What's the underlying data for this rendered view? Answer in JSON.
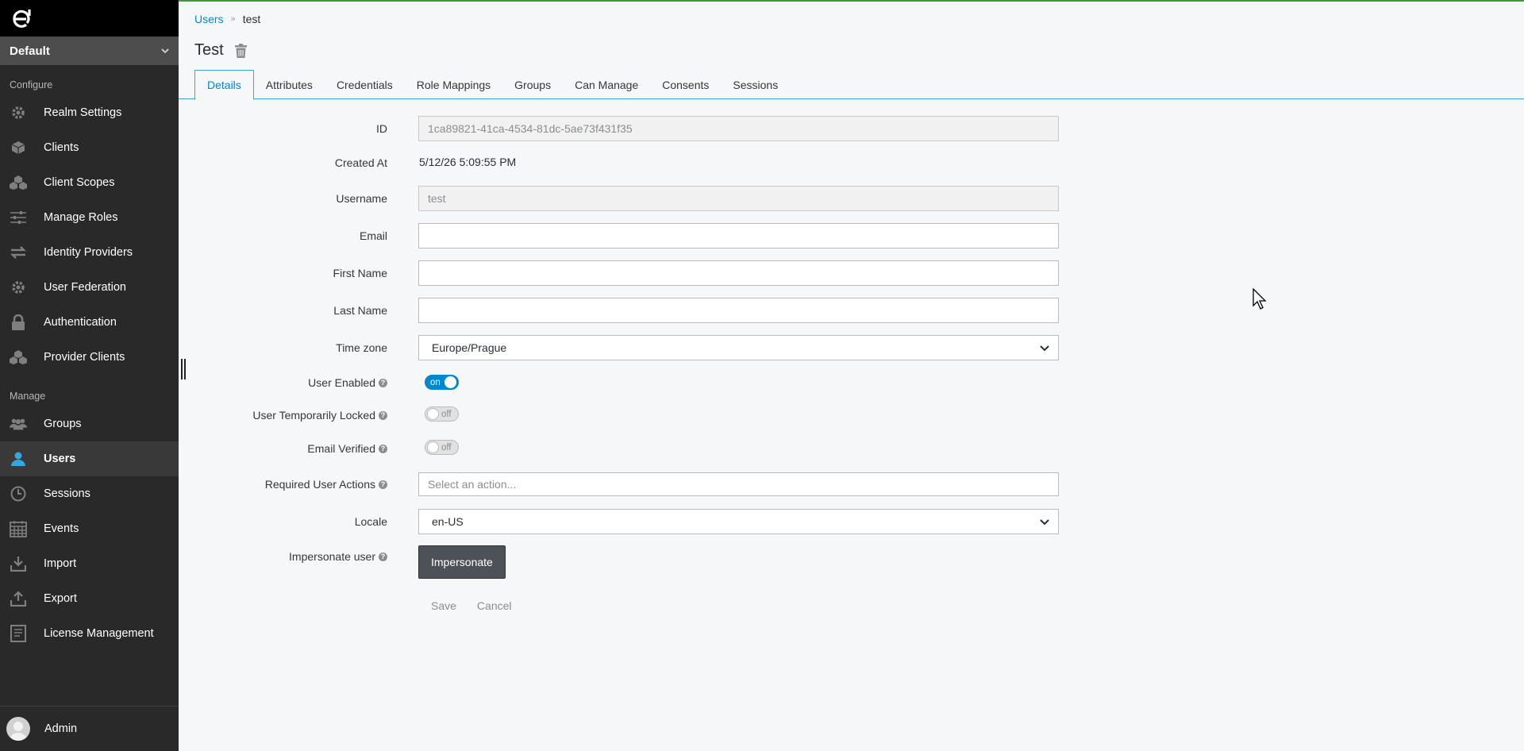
{
  "sidebar": {
    "realm": "Default",
    "configure_label": "Configure",
    "configure_items": [
      {
        "label": "Realm Settings",
        "icon": "sliders-icon"
      },
      {
        "label": "Clients",
        "icon": "cube-icon"
      },
      {
        "label": "Client Scopes",
        "icon": "cubes-icon"
      },
      {
        "label": "Manage Roles",
        "icon": "sliders-icon"
      },
      {
        "label": "Identity Providers",
        "icon": "exchange-icon"
      },
      {
        "label": "User Federation",
        "icon": "gear-icon"
      },
      {
        "label": "Authentication",
        "icon": "lock-icon"
      },
      {
        "label": "Provider Clients",
        "icon": "cubes-icon"
      }
    ],
    "manage_label": "Manage",
    "manage_items": [
      {
        "label": "Groups",
        "icon": "users-icon"
      },
      {
        "label": "Users",
        "icon": "user-icon"
      },
      {
        "label": "Sessions",
        "icon": "clock-icon"
      },
      {
        "label": "Events",
        "icon": "calendar-icon"
      },
      {
        "label": "Import",
        "icon": "import-icon"
      },
      {
        "label": "Export",
        "icon": "export-icon"
      },
      {
        "label": "License Management",
        "icon": "license-icon"
      }
    ],
    "footer_user": "Admin"
  },
  "breadcrumb": {
    "parent": "Users",
    "current": "test"
  },
  "page": {
    "title": "Test"
  },
  "tabs": [
    "Details",
    "Attributes",
    "Credentials",
    "Role Mappings",
    "Groups",
    "Can Manage",
    "Consents",
    "Sessions"
  ],
  "form": {
    "id_label": "ID",
    "id_value": "1ca89821-41ca-4534-81dc-5ae73f431f35",
    "created_label": "Created At",
    "created_value": "5/12/26 5:09:55 PM",
    "username_label": "Username",
    "username_value": "test",
    "email_label": "Email",
    "email_value": "",
    "firstname_label": "First Name",
    "firstname_value": "",
    "lastname_label": "Last Name",
    "lastname_value": "",
    "timezone_label": "Time zone",
    "timezone_value": "Europe/Prague",
    "enabled_label": "User Enabled",
    "enabled_state": "on",
    "locked_label": "User Temporarily Locked",
    "locked_state": "off",
    "verified_label": "Email Verified",
    "verified_state": "off",
    "actions_label": "Required User Actions",
    "actions_placeholder": "Select an action...",
    "locale_label": "Locale",
    "locale_value": "en-US",
    "impersonate_label": "Impersonate user",
    "impersonate_button": "Impersonate",
    "save_button": "Save",
    "cancel_button": "Cancel"
  }
}
